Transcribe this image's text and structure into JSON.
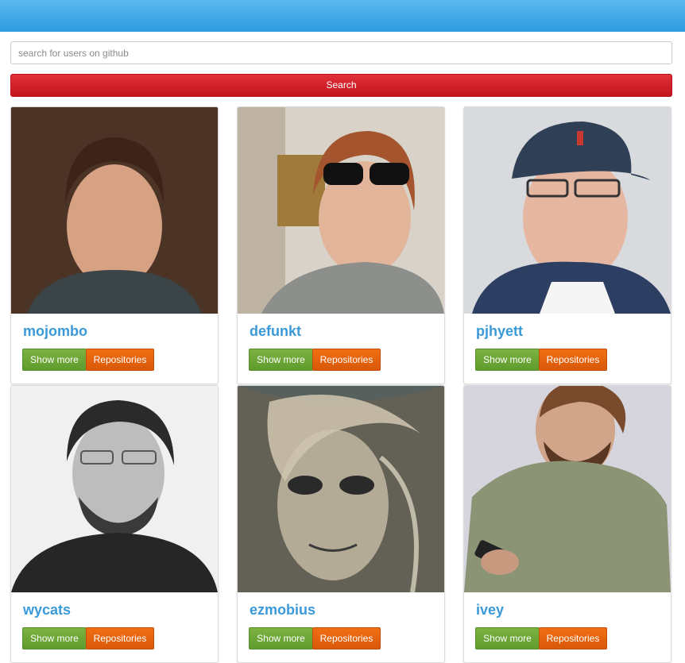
{
  "search": {
    "placeholder": "search for users on github",
    "value": "",
    "button_label": "Search"
  },
  "users": [
    {
      "username": "mojombo",
      "show_more_label": "Show more",
      "repos_label": "Repositories"
    },
    {
      "username": "defunkt",
      "show_more_label": "Show more",
      "repos_label": "Repositories"
    },
    {
      "username": "pjhyett",
      "show_more_label": "Show more",
      "repos_label": "Repositories"
    },
    {
      "username": "wycats",
      "show_more_label": "Show more",
      "repos_label": "Repositories"
    },
    {
      "username": "ezmobius",
      "show_more_label": "Show more",
      "repos_label": "Repositories"
    },
    {
      "username": "ivey",
      "show_more_label": "Show more",
      "repos_label": "Repositories"
    }
  ],
  "colors": {
    "header": "#2e9be2",
    "search_button": "#d42028",
    "username": "#3a9ad9",
    "show_more": "#6aa634",
    "repositories": "#e5620c"
  }
}
